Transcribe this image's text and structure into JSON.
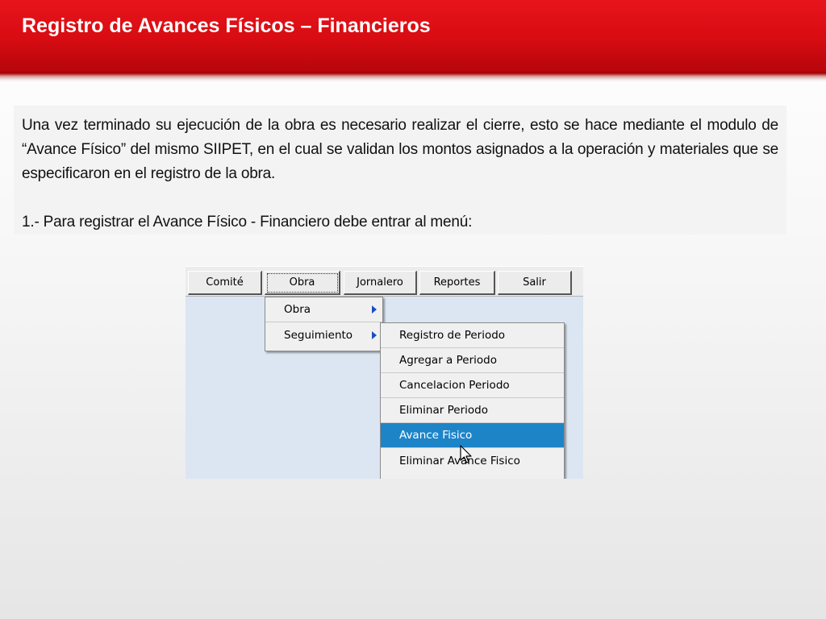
{
  "slide": {
    "title": "Registro de Avances Físicos – Financieros",
    "paragraph1": "Una vez terminado su ejecución de la obra es necesario realizar el cierre, esto se hace mediante el modulo de “Avance Físico” del mismo SIIPET, en el cual se validan los montos asignados a la operación y materiales que se especificaron en el registro de la obra.",
    "paragraph2": "1.- Para registrar el Avance Físico - Financiero debe entrar al menú:"
  },
  "menubar": {
    "items": [
      {
        "label": "Comité"
      },
      {
        "label": "Obra"
      },
      {
        "label": "Jornalero"
      },
      {
        "label": "Reportes"
      },
      {
        "label": "Salir"
      }
    ]
  },
  "obra_menu": {
    "items": [
      {
        "label": "Obra"
      },
      {
        "label": "Seguimiento"
      }
    ]
  },
  "seguimiento_menu": {
    "items": [
      {
        "label": "Registro de Periodo"
      },
      {
        "label": "Agregar a Periodo"
      },
      {
        "label": "Cancelacion Periodo"
      },
      {
        "label": "Eliminar Periodo"
      },
      {
        "label": "Avance Fisico"
      },
      {
        "label": "Eliminar Avance Fisico"
      }
    ],
    "selected": "Avance Fisico"
  },
  "colors": {
    "header_red": "#e8141c",
    "selection_blue": "#1e84c8",
    "screen_background": "#dce6f2"
  }
}
